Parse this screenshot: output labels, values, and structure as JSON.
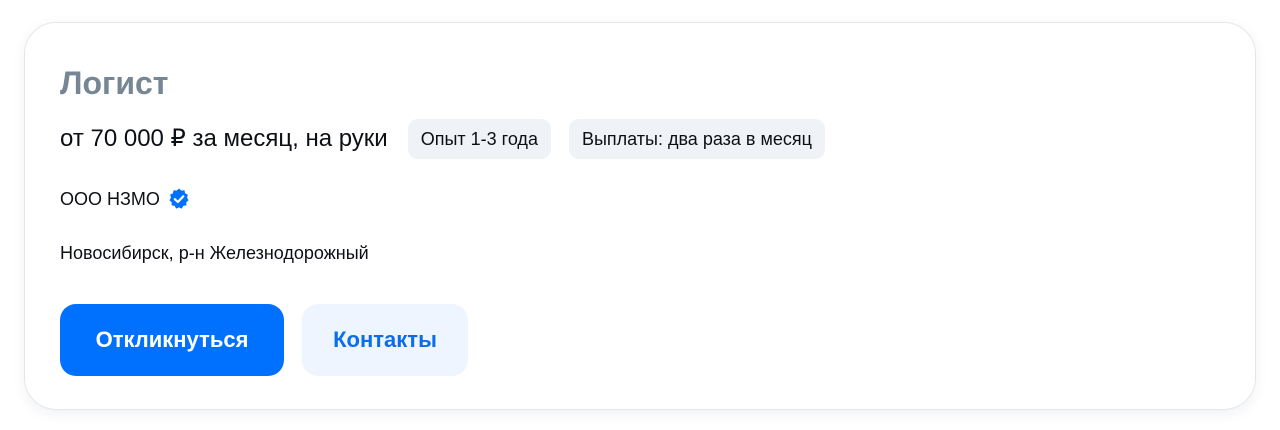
{
  "vacancy": {
    "title": "Логист",
    "salary": "от 70 000 ₽ за месяц, на руки",
    "chips": [
      {
        "label": "Опыт 1-3 года"
      },
      {
        "label": "Выплаты: два раза в месяц"
      }
    ],
    "company": "ООО НЗМО",
    "company_verified_icon": "verified-badge-icon",
    "location": "Новосибирск, р-н Железнодорожный"
  },
  "actions": {
    "respond_label": "Откликнуться",
    "contacts_label": "Контакты"
  },
  "colors": {
    "primary": "#0070ff",
    "primary_text": "#ffffff",
    "secondary_bg": "#eef5ff",
    "secondary_text": "#0a6eeb",
    "title": "#768694",
    "chip_bg": "#eff2f6",
    "text": "#0c0f14"
  }
}
